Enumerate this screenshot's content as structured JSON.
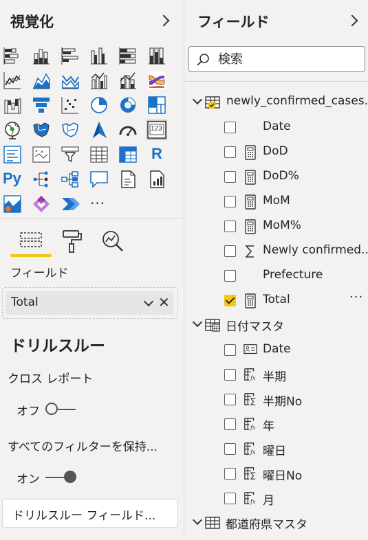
{
  "visualizations": {
    "title": "視覚化",
    "fields_label": "フィールド",
    "field_well_value": "Total",
    "drillthrough": {
      "heading": "ドリルスルー",
      "cross_report_label": "クロス レポート",
      "cross_report_state": "オフ",
      "keep_filters_label": "すべてのフィルターを保持...",
      "keep_filters_state": "オン",
      "field_placeholder": "ドリルスルー フィールド..."
    },
    "gallery_icons": [
      "stacked-bar-chart-icon",
      "stacked-column-chart-icon",
      "clustered-bar-chart-icon",
      "clustered-column-chart-icon",
      "100-stacked-bar-chart-icon",
      "100-stacked-column-chart-icon",
      "line-chart-icon",
      "area-chart-icon",
      "stacked-area-chart-icon",
      "line-clustered-column-chart-icon",
      "line-stacked-column-chart-icon",
      "ribbon-chart-icon",
      "waterfall-chart-icon",
      "funnel-chart-icon",
      "scatter-chart-icon",
      "pie-chart-icon",
      "donut-chart-icon",
      "treemap-icon",
      "map-icon",
      "filled-map-icon",
      "shape-map-icon",
      "azure-map-icon",
      "gauge-icon",
      "card-icon",
      "multi-row-card-icon",
      "kpi-icon",
      "slicer-icon",
      "table-icon",
      "matrix-icon",
      "r-visual-icon",
      "python-visual-icon",
      "key-influencers-icon",
      "decomposition-tree-icon",
      "qa-icon",
      "paginated-report-icon",
      "smart-narrative-icon",
      "arcgis-map-icon",
      "power-apps-icon",
      "power-automate-icon",
      "more-visuals-icon"
    ],
    "r_text": "R",
    "py_text": "Py",
    "card_text": "123",
    "more_text": "···"
  },
  "fields": {
    "title": "フィールド",
    "search_placeholder": "検索",
    "tables": [
      {
        "name": "newly_confirmed_cases...",
        "fields": [
          {
            "label": "Date",
            "checked": false,
            "icon": "none"
          },
          {
            "label": "DoD",
            "checked": false,
            "icon": "calculator-icon"
          },
          {
            "label": "DoD%",
            "checked": false,
            "icon": "calculator-icon"
          },
          {
            "label": "MoM",
            "checked": false,
            "icon": "calculator-icon"
          },
          {
            "label": "MoM%",
            "checked": false,
            "icon": "calculator-icon"
          },
          {
            "label": "Newly confirmed...",
            "checked": false,
            "icon": "sigma-icon"
          },
          {
            "label": "Prefecture",
            "checked": false,
            "icon": "none"
          },
          {
            "label": "Total",
            "checked": true,
            "icon": "calculator-icon",
            "more": "···"
          }
        ]
      },
      {
        "name": "日付マスタ",
        "fields": [
          {
            "label": "Date",
            "checked": false,
            "icon": "id-card-icon"
          },
          {
            "label": "半期",
            "checked": false,
            "icon": "calculated-column-icon"
          },
          {
            "label": "半期No",
            "checked": false,
            "icon": "sum-column-icon"
          },
          {
            "label": "年",
            "checked": false,
            "icon": "calculated-column-icon"
          },
          {
            "label": "曜日",
            "checked": false,
            "icon": "calculated-column-icon"
          },
          {
            "label": "曜日No",
            "checked": false,
            "icon": "sum-column-icon"
          },
          {
            "label": "月",
            "checked": false,
            "icon": "calculated-column-icon"
          }
        ]
      },
      {
        "name": "都道府県マスタ",
        "fields": []
      }
    ]
  },
  "colors": {
    "accent": "#f2c811",
    "background": "#f3f2f1",
    "text": "#252423"
  }
}
